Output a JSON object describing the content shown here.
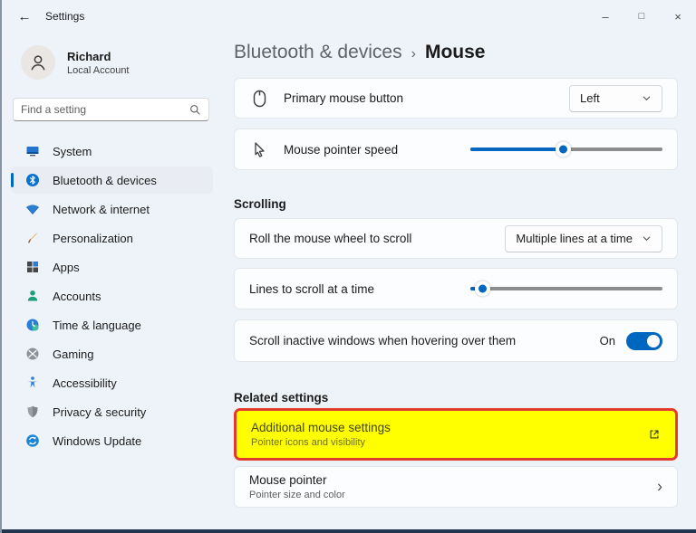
{
  "titlebar": {
    "back": "←",
    "title": "Settings",
    "minimize": "–",
    "maximize": "□",
    "close": "×"
  },
  "profile": {
    "name": "Richard",
    "subtitle": "Local Account"
  },
  "search": {
    "placeholder": "Find a setting"
  },
  "sidebar": {
    "items": [
      {
        "label": "System",
        "icon": "monitor-icon",
        "selected": false
      },
      {
        "label": "Bluetooth & devices",
        "icon": "bluetooth-icon",
        "selected": true
      },
      {
        "label": "Network & internet",
        "icon": "globe-icon",
        "selected": false
      },
      {
        "label": "Personalization",
        "icon": "brush-icon",
        "selected": false
      },
      {
        "label": "Apps",
        "icon": "apps-icon",
        "selected": false
      },
      {
        "label": "Accounts",
        "icon": "person-icon",
        "selected": false
      },
      {
        "label": "Time & language",
        "icon": "clock-icon",
        "selected": false
      },
      {
        "label": "Gaming",
        "icon": "xbox-icon",
        "selected": false
      },
      {
        "label": "Accessibility",
        "icon": "accessibility-icon",
        "selected": false
      },
      {
        "label": "Privacy & security",
        "icon": "shield-icon",
        "selected": false
      },
      {
        "label": "Windows Update",
        "icon": "update-icon",
        "selected": false
      }
    ]
  },
  "header": {
    "breadcrumb_parent": "Bluetooth & devices",
    "separator": "›",
    "title": "Mouse"
  },
  "settings": {
    "primary_button": {
      "label": "Primary mouse button",
      "value": "Left"
    },
    "pointer_speed": {
      "label": "Mouse pointer speed",
      "percent": 48
    },
    "scrolling_section": "Scrolling",
    "roll_wheel": {
      "label": "Roll the mouse wheel to scroll",
      "value": "Multiple lines at a time"
    },
    "lines_scroll": {
      "label": "Lines to scroll at a time",
      "percent": 6
    },
    "inactive_windows": {
      "label": "Scroll inactive windows when hovering over them",
      "state": "On"
    },
    "related_section": "Related settings",
    "additional_mouse": {
      "title": "Additional mouse settings",
      "subtitle": "Pointer icons and visibility"
    },
    "mouse_pointer": {
      "title": "Mouse pointer",
      "subtitle": "Pointer size and color",
      "chevron": "›"
    }
  },
  "colors": {
    "accent": "#0067c0",
    "highlight_background": "#ffff00",
    "highlight_border": "#e23b2e",
    "card_background": "#fbfdfe",
    "window_background": "#eef2f9"
  }
}
